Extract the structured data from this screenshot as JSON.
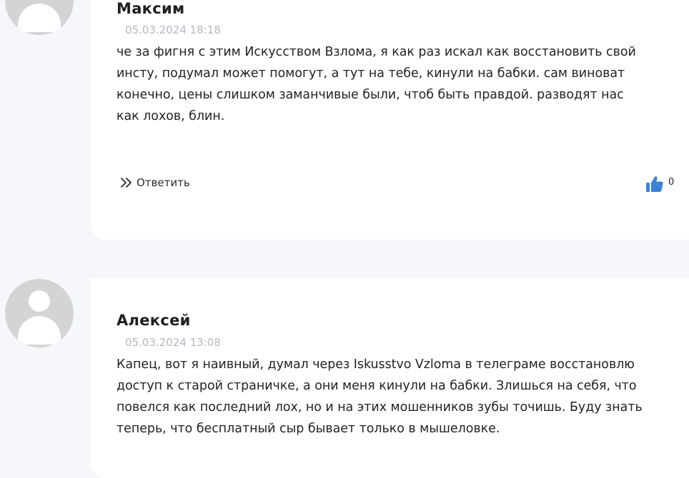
{
  "comments": [
    {
      "author": "Максим",
      "date": "05.03.2024 18:18",
      "lines": [
        "че за фигня с этим Искусством Взлома, я как раз искал как восстановить свой",
        "инсту, подумал может помогут, а тут на тебе, кинули на бабки. сам виноват",
        "конечно, цены слишком заманчивые были, чтоб быть правдой. разводят нас",
        "как лохов, блин."
      ],
      "reply_label": "Ответить",
      "likes": "0"
    },
    {
      "author": "Алексей",
      "date": "05.03.2024 13:08",
      "lines": [
        "Капец, вот я наивный, думал через Iskusstvo Vzloma в телеграме восстановлю",
        "доступ к старой страничке, а они меня кинули на бабки. Злишься на себя, что",
        "повелся как последний лох, но и на этих мошенников зубы точишь. Буду знать",
        "теперь, что бесплатный сыр бывает только в мышеловке."
      ]
    }
  ],
  "icons": {
    "reply": "double-chevron-right-icon",
    "like": "thumbs-up-icon",
    "avatar": "default-user-avatar"
  },
  "colors": {
    "page_bg": "#f6f7fb",
    "card_bg": "#ffffff",
    "avatar_bg": "#d4d4d4",
    "date": "#b3b8c3",
    "like_icon": "#3b82d6"
  }
}
